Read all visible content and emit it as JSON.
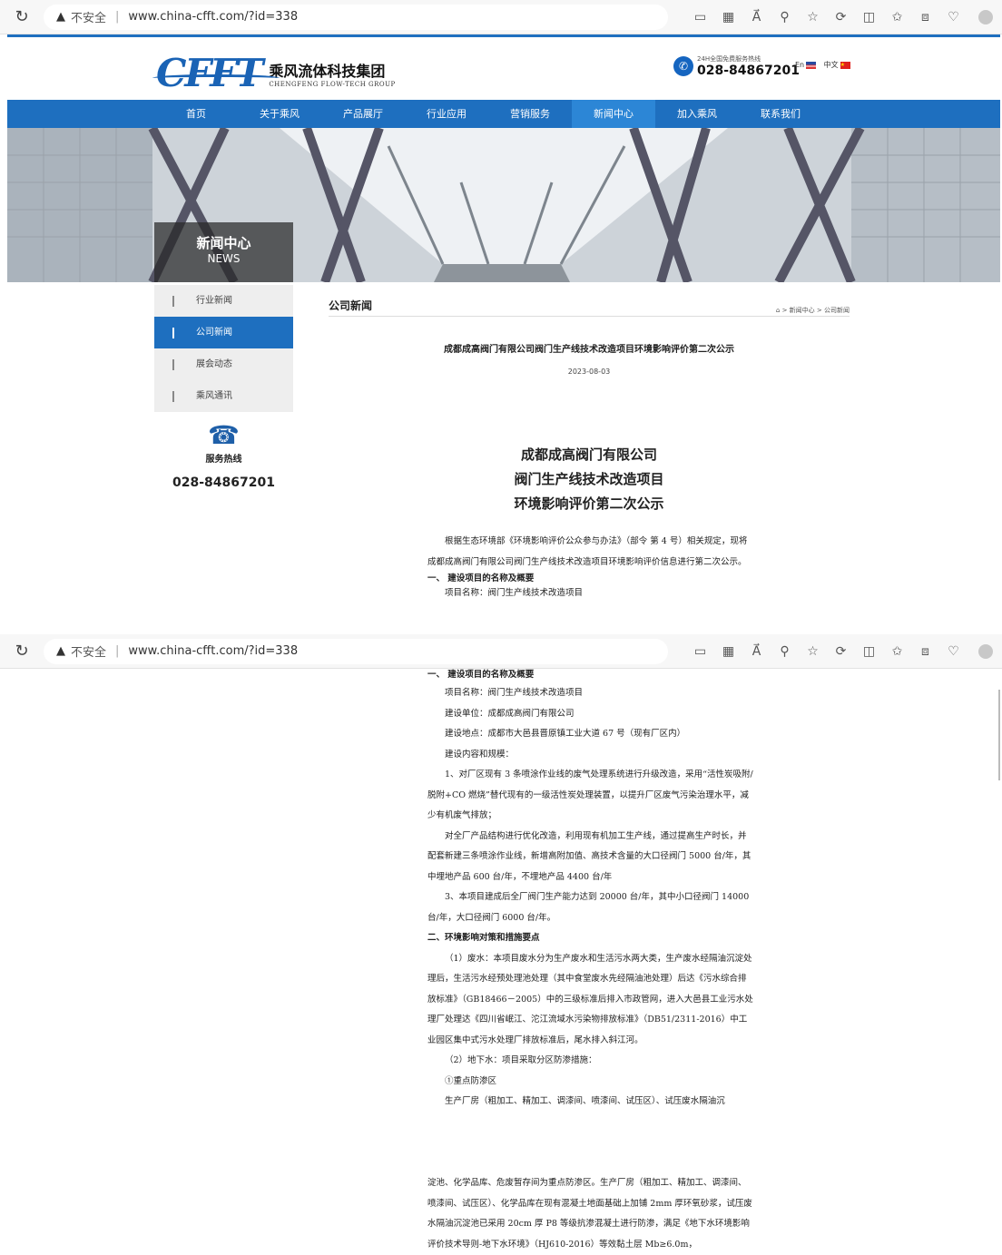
{
  "browser": {
    "insecure_label": "不安全",
    "url": "www.china-cfft.com/?id=338"
  },
  "header": {
    "logo_en": "CFFT",
    "logo_cn": "乘风流体科技集团",
    "logo_sub": "CHENGFENG FLOW-TECH GROUP",
    "hotline_caption": "24H全国免费服务热线",
    "hotline_number": "028-84867201",
    "lang_en": "En",
    "lang_cn": "中文"
  },
  "nav": {
    "items": [
      "首页",
      "关于乘风",
      "产品展厅",
      "行业应用",
      "营销服务",
      "新闻中心",
      "加入乘风",
      "联系我们"
    ],
    "active": "新闻中心"
  },
  "banner": {
    "title_cn": "新闻中心",
    "title_en": "NEWS"
  },
  "sidebar": {
    "items": [
      "行业新闻",
      "公司新闻",
      "展会动态",
      "乘风通讯"
    ],
    "active": "公司新闻",
    "service_label": "服务热线",
    "service_number": "028-84867201"
  },
  "main": {
    "section_title": "公司新闻",
    "breadcrumb": "> 新闻中心 > 公司新闻",
    "article_title": "成都成高阀门有限公司阀门生产线技术改造项目环境影响评价第二次公示",
    "article_date": "2023-08-03",
    "heading_lines": [
      "成都成高阀门有限公司",
      "阀门生产线技术改造项目",
      "环境影响评价第二次公示"
    ]
  },
  "article": {
    "p_intro": "根据生态环境部《环境影响评价公众参与办法》（部令 第 4 号）相关规定，现将成都成高阀门有限公司阀门生产线技术改造项目环境影响评价信息进行第二次公示。",
    "s1_title": "一、 建设项目的名称及概要",
    "s1_name": "项目名称：阀门生产线技术改造项目",
    "s1_unit": "建设单位：成都成高阀门有限公司",
    "s1_place": "建设地点：成都市大邑县晋原镇工业大道 67 号（现有厂区内）",
    "s1_scope": "建设内容和规模：",
    "s1_p1": "1、对厂区现有 3 条喷涂作业线的废气处理系统进行升级改造，采用“活性炭吸附/脱附+CO 燃烧”替代现有的一级活性炭处理装置，以提升厂区废气污染治理水平，减少有机废气排放；",
    "s1_p2": "对全厂产品结构进行优化改造，利用现有机加工生产线，通过提高生产时长，并配套新建三条喷涂作业线，新增高附加值、高技术含量的大口径阀门 5000 台/年，其中埋地产品 600 台/年，不埋地产品 4400 台/年",
    "s1_p3": "3、本项目建成后全厂阀门生产能力达到 20000 台/年，其中小口径阀门 14000 台/年，大口径阀门 6000 台/年。",
    "s2_title": "二、环境影响对策和措施要点",
    "s2_p1": "（1）废水：本项目废水分为生产废水和生活污水两大类，生产废水经隔油沉淀处理后，生活污水经预处理池处理（其中食堂废水先经隔油池处理）后达《污水综合排放标准》（GB18466－2005）中的三级标准后排入市政管网，进入大邑县工业污水处理厂处理达《四川省岷江、沱江流域水污染物排放标准》（DB51/2311-2016）中工业园区集中式污水处理厂排放标准后，尾水排入斜江河。",
    "s2_p2": "（2）地下水：项目采取分区防渗措施：",
    "s2_p3": "①重点防渗区",
    "s2_p4": "生产厂房（粗加工、精加工、调漆间、喷漆间、试压区）、试压废水隔油沉",
    "s2_p5": "淀池、化学品库、危废暂存间为重点防渗区。生产厂房（粗加工、精加工、调漆间、喷漆间、试压区）、化学品库在现有混凝土地面基础上加铺 2mm 厚环氧砂浆，试压废水隔油沉淀池已采用 20cm 厚 P8 等级抗渗混凝土进行防渗，满足《地下水环境影响评价技术导则-地下水环境》（HJ610-2016）等效黏土层 Mb≥6.0m，"
  }
}
